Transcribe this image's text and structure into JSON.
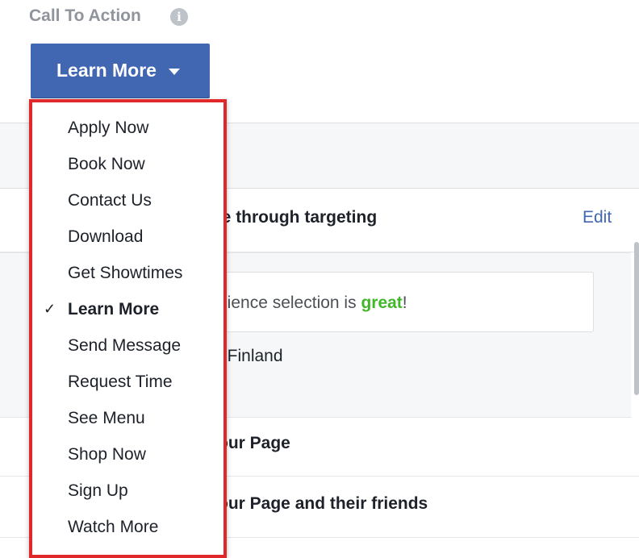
{
  "header": {
    "title": "Call To Action",
    "info_icon": "i",
    "button_label": "Learn More"
  },
  "background": {
    "targeting_text": "se through targeting",
    "edit_link": "Edit",
    "audience_prefix": "dience selection is ",
    "audience_great": "great",
    "audience_suffix": "!",
    "location_text": ": Finland",
    "row1_text": "our Page",
    "row2_text": "our Page and their friends"
  },
  "dropdown": {
    "items": [
      {
        "label": "Apply Now"
      },
      {
        "label": "Book Now"
      },
      {
        "label": "Contact Us"
      },
      {
        "label": "Download"
      },
      {
        "label": "Get Showtimes"
      },
      {
        "label": "Learn More",
        "selected": true,
        "check": "✓"
      },
      {
        "label": "Send Message"
      },
      {
        "label": "Request Time"
      },
      {
        "label": "See Menu"
      },
      {
        "label": "Shop Now"
      },
      {
        "label": "Sign Up"
      },
      {
        "label": "Watch More"
      }
    ],
    "highlight_color": "#e0282b"
  },
  "colors": {
    "primary": "#4267b2",
    "positive": "#42b72a"
  }
}
